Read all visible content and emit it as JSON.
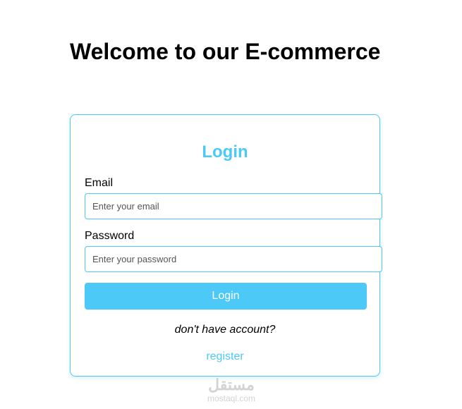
{
  "header": {
    "title": "Welcome to our E-commerce"
  },
  "login_form": {
    "heading": "Login",
    "email": {
      "label": "Email",
      "placeholder": "Enter your email",
      "value": ""
    },
    "password": {
      "label": "Password",
      "placeholder": "Enter your password",
      "value": ""
    },
    "submit_label": "Login",
    "no_account_text": "don't have account?",
    "register_label": "register"
  },
  "watermark": {
    "logo_text": "مستقل",
    "text": "mostaql.com"
  },
  "colors": {
    "accent": "#4cc9f7",
    "text": "#000000",
    "background": "#ffffff",
    "watermark": "#d3d3d3"
  }
}
